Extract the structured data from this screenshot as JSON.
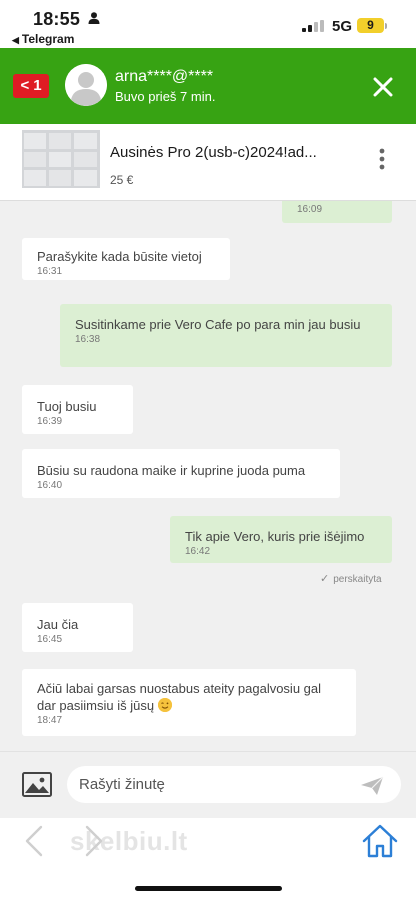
{
  "status_bar": {
    "time": "18:55",
    "back_app": "Telegram",
    "network": "5G",
    "battery": "9"
  },
  "header": {
    "back_count": "1",
    "contact_name": "arna****@****",
    "contact_status": "Buvo prieš 7 min."
  },
  "product": {
    "title": "Ausinės Pro 2(usb-c)2024!ad...",
    "price": "25 €"
  },
  "messages": [
    {
      "direction": "out",
      "text": "",
      "time": "16:09"
    },
    {
      "direction": "in",
      "text": "Parašykite kada būsite vietoj",
      "time": "16:31"
    },
    {
      "direction": "out",
      "text": "Susitinkame prie Vero Cafe po para min jau busiu",
      "time": "16:38"
    },
    {
      "direction": "in",
      "text": "Tuoj busiu",
      "time": "16:39"
    },
    {
      "direction": "in",
      "text": "Būsiu su raudona maike ir kuprine juoda puma",
      "time": "16:40"
    },
    {
      "direction": "out",
      "text": "Tik apie Vero, kuris prie išėjimo",
      "time": "16:42"
    },
    {
      "direction": "in",
      "text": "Jau čia",
      "time": "16:45"
    },
    {
      "direction": "in",
      "text": "Ačiū labai garsas nuostabus ateity pagalvosiu gal dar pasiimsiu iš jūsų",
      "time": "18:47"
    }
  ],
  "read_receipt": "perskaityta",
  "composer": {
    "placeholder": "Rašyti žinutę"
  },
  "watermark": "skelbiu.lt",
  "colors": {
    "header_green": "#37a313",
    "back_red": "#df1c24",
    "outgoing_bubble": "#dcefd3",
    "incoming_bubble": "#ffffff",
    "chat_background": "#f0f0f0",
    "home_icon_blue": "#2c7fd6"
  },
  "icons": {
    "person": "person-icon",
    "signal": "signal-bars-icon",
    "close": "close-icon",
    "more": "more-vertical-icon",
    "image": "image-icon",
    "send": "send-icon",
    "home": "home-icon"
  }
}
